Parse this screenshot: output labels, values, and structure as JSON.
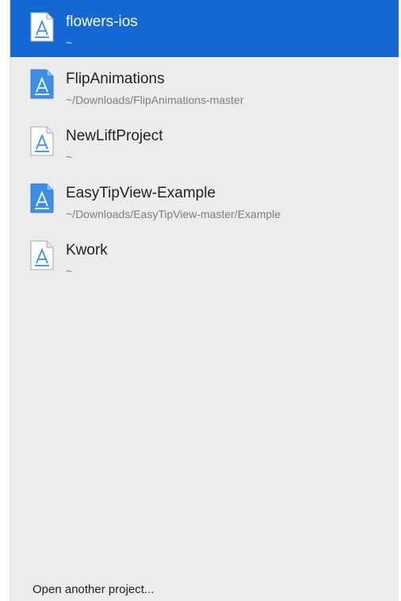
{
  "projects": [
    {
      "name": "flowers-ios",
      "path": "~",
      "icon": "xcode-project-icon",
      "selected": true
    },
    {
      "name": "FlipAnimations",
      "path": "~/Downloads/FlipAnimations-master",
      "icon": "xcode-app-project-icon",
      "selected": false
    },
    {
      "name": "NewLiftProject",
      "path": "~",
      "icon": "xcode-project-icon",
      "selected": false
    },
    {
      "name": "EasyTipView-Example",
      "path": "~/Downloads/EasyTipView-master/Example",
      "icon": "xcode-app-project-icon",
      "selected": false
    },
    {
      "name": "Kwork",
      "path": "~",
      "icon": "xcode-project-icon",
      "selected": false
    }
  ],
  "footer": {
    "open_another_label": "Open another project..."
  },
  "colors": {
    "selection": "#1468d6",
    "panel": "#ececec"
  }
}
